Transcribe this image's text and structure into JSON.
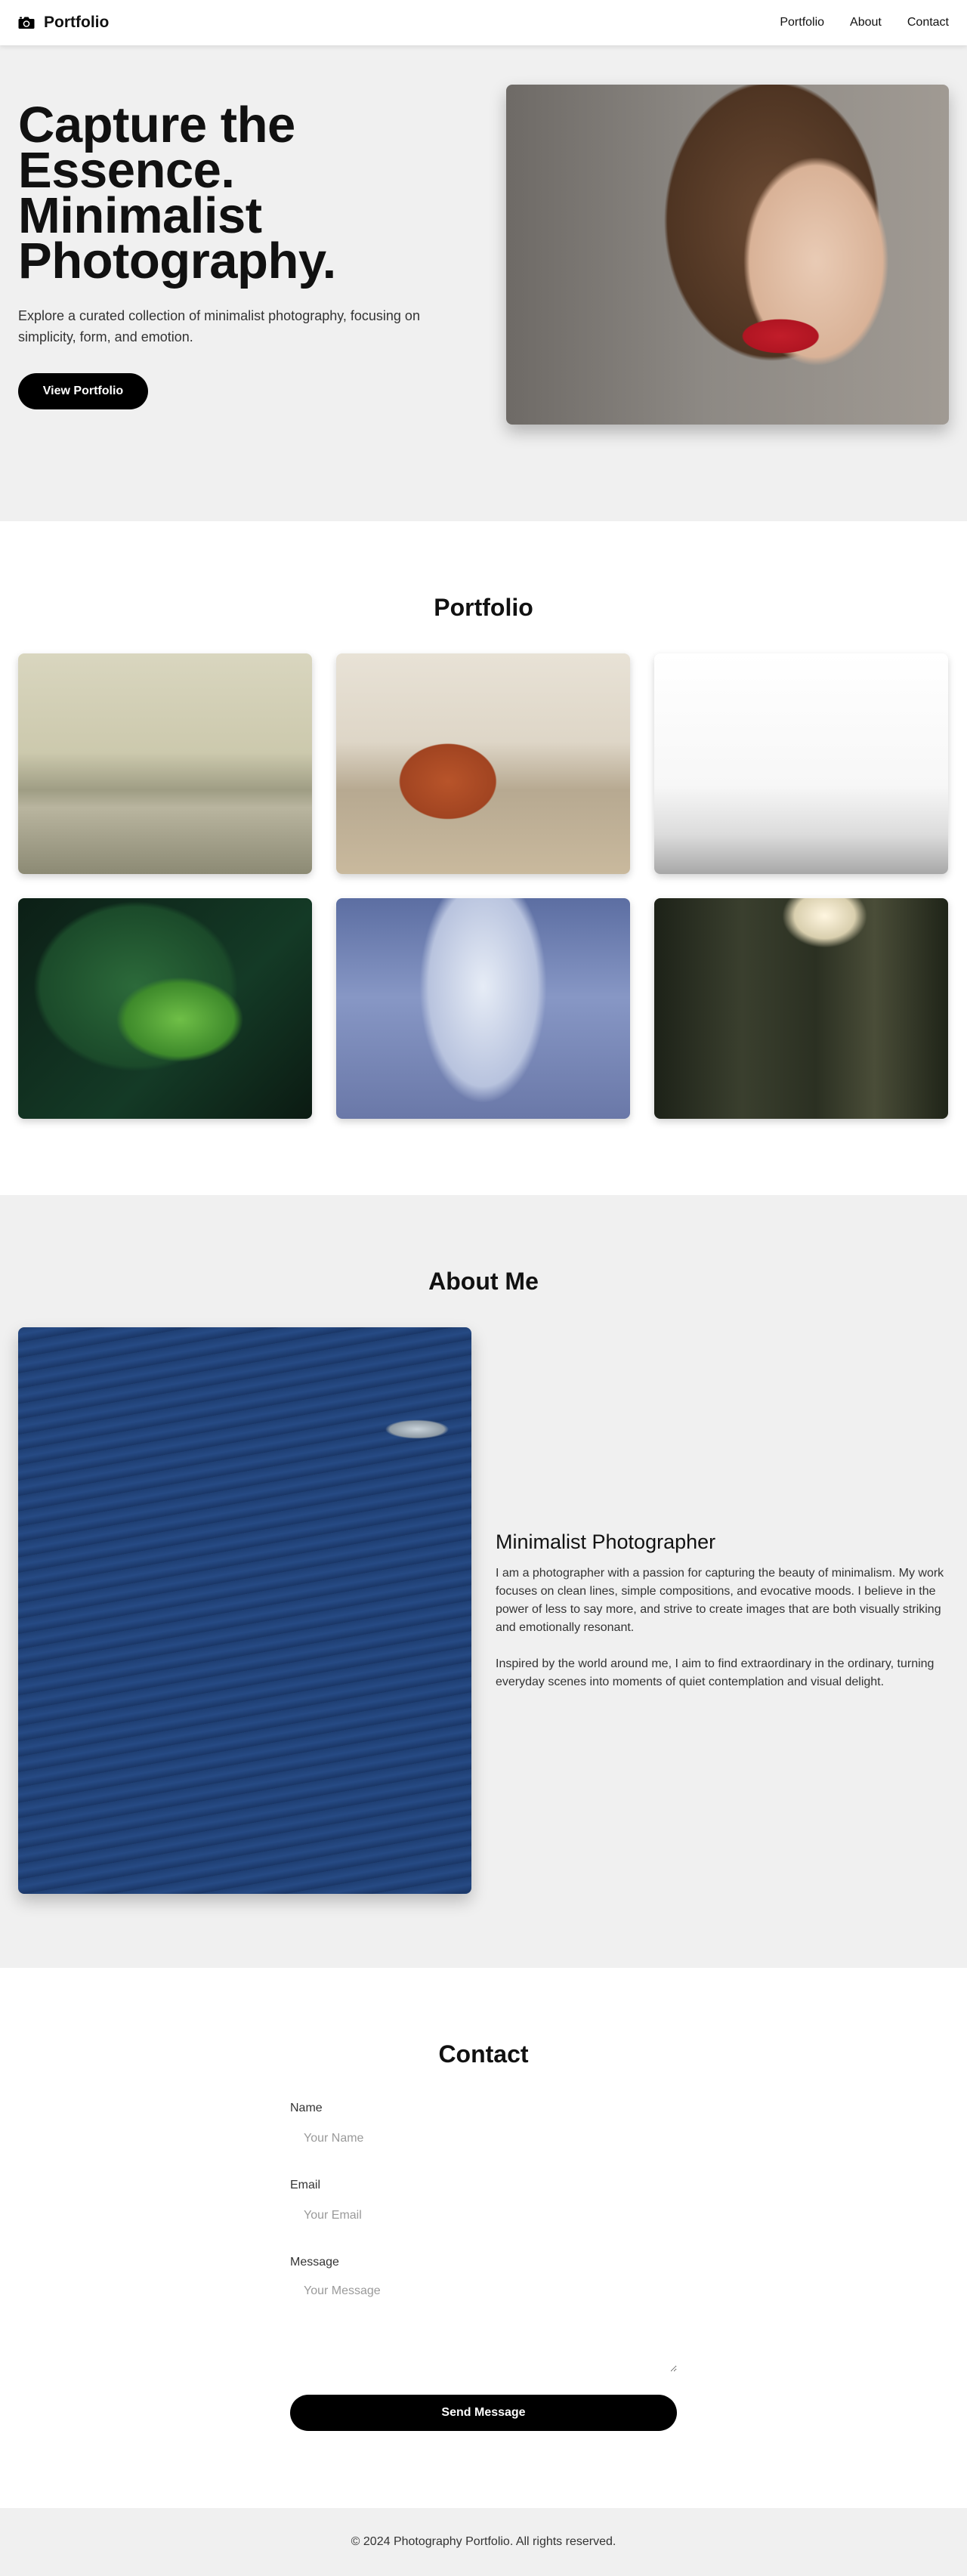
{
  "nav": {
    "brand": "Portfolio",
    "brand_icon": "camera-icon",
    "links": [
      "Portfolio",
      "About",
      "Contact"
    ]
  },
  "hero": {
    "title": "Capture the Essence. Minimalist Photography.",
    "subtitle": "Explore a curated collection of minimalist photography, focusing on simplicity, form, and emotion.",
    "button": "View Portfolio"
  },
  "portfolio": {
    "title": "Portfolio",
    "images": [
      "beach-photo",
      "highland-cow-photo",
      "hay-bales-field-photo",
      "green-plant-photo",
      "skyscraper-photo",
      "forest-photo"
    ]
  },
  "about": {
    "title": "About Me",
    "heading": "Minimalist Photographer",
    "paragraphs": [
      "I am a photographer with a passion for capturing the beauty of minimalism. My work focuses on clean lines, simple compositions, and evocative moods. I believe in the power of less to say more, and strive to create images that are both visually striking and emotionally resonant.",
      "Inspired by the world around me, I aim to find extraordinary in the ordinary, turning everyday scenes into moments of quiet contemplation and visual delight."
    ]
  },
  "contact": {
    "title": "Contact",
    "name_label": "Name",
    "name_placeholder": "Your Name",
    "email_label": "Email",
    "email_placeholder": "Your Email",
    "message_label": "Message",
    "message_placeholder": "Your Message",
    "button": "Send Message"
  },
  "footer": {
    "text": "© 2024 Photography Portfolio. All rights reserved."
  },
  "colors": {
    "accent": "#000000",
    "section_gray": "#f0f0f0",
    "background": "#ffffff"
  }
}
